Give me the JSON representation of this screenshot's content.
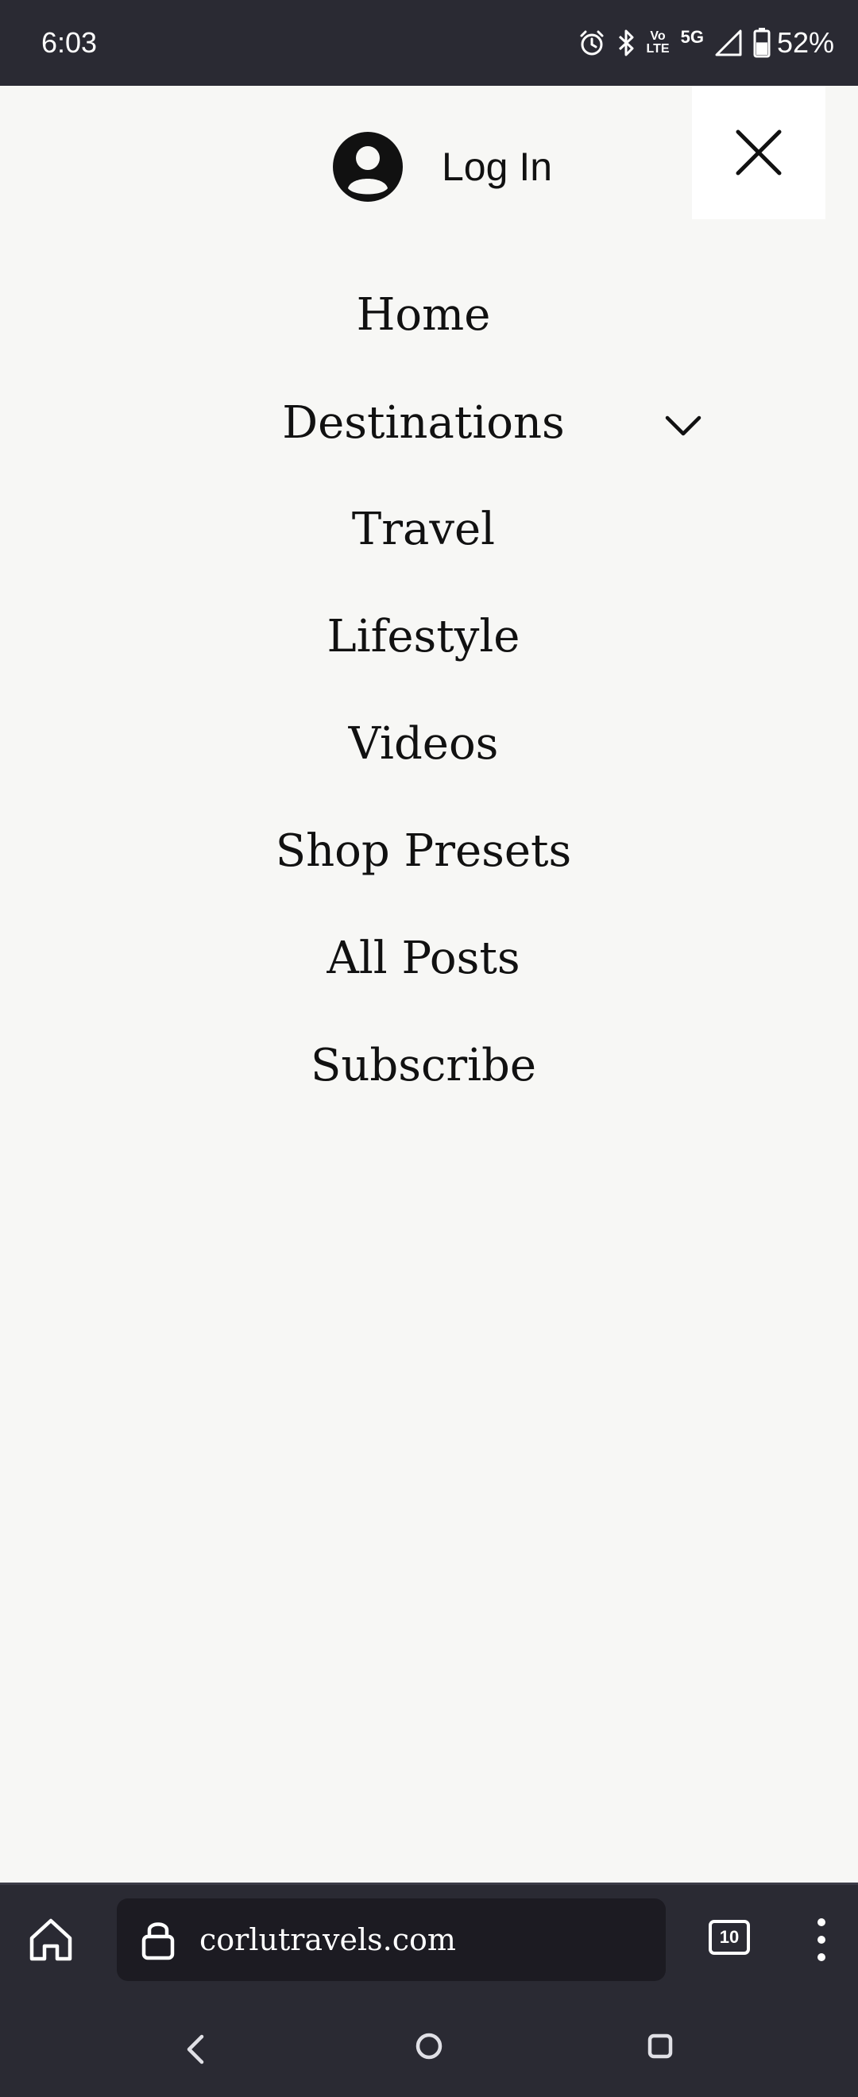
{
  "status_bar": {
    "time": "6:03",
    "lte_top": "Vo",
    "lte_bottom": "LTE",
    "network": "5G",
    "battery": "52%",
    "battery_level": 0.52,
    "icons": [
      "alarm-icon",
      "bluetooth-icon",
      "volte-icon",
      "signal-icon",
      "battery-icon"
    ]
  },
  "menu": {
    "login_label": "Log In",
    "items": [
      {
        "label": "Home"
      },
      {
        "label": "Destinations",
        "has_submenu": true
      },
      {
        "label": "Travel"
      },
      {
        "label": "Lifestyle"
      },
      {
        "label": "Videos"
      },
      {
        "label": "Shop Presets"
      },
      {
        "label": "All Posts"
      },
      {
        "label": "Subscribe"
      }
    ]
  },
  "browser": {
    "url": "corlutravels.com",
    "tab_count": "10"
  },
  "colors": {
    "system_bar": "#2a2a33",
    "url_field": "#1c1b22",
    "page_background": "#f7f7f5",
    "text": "#111111"
  }
}
